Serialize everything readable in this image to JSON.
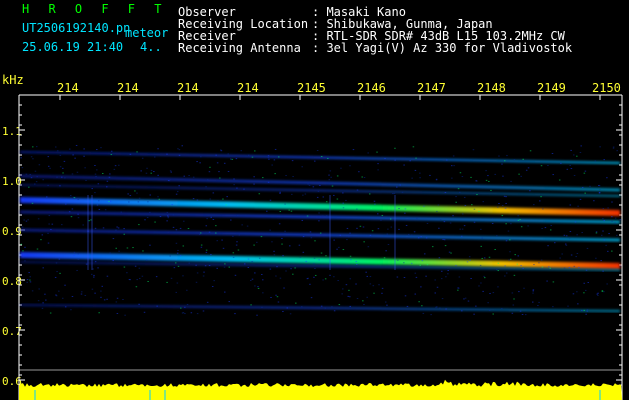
{
  "header": {
    "brand": "H R O F F T",
    "filename": "UT2506192140.pn",
    "mode": "meteor",
    "datetime": "25.06.19 21:40",
    "count": "4..",
    "fields": [
      {
        "label": "Observer",
        "value": ": Masaki Kano"
      },
      {
        "label": "Receiving Location",
        "value": ": Shibukawa, Gunma, Japan"
      },
      {
        "label": "Receiver",
        "value": ": RTL-SDR SDR# 43dB L15 103.2MHz CW"
      },
      {
        "label": "Receiving Antenna",
        "value": ": 3el Yagi(V) Az 330 for Vladivostok"
      }
    ]
  },
  "axis": {
    "unit": "kHz",
    "time_ticks": [
      "214",
      "214",
      "214",
      "214",
      "2145",
      "2146",
      "2147",
      "2148",
      "2149",
      "2150"
    ],
    "freq_ticks": [
      "1.1",
      "1.0",
      "0.9",
      "0.8",
      "0.7",
      "0.6"
    ]
  },
  "colors": {
    "grid": "#ffffff",
    "signal_high": "#ff3300",
    "signal_mid": "#00ff66",
    "signal_low": "#1a3cff",
    "noise_floor": "#ffff00"
  }
}
